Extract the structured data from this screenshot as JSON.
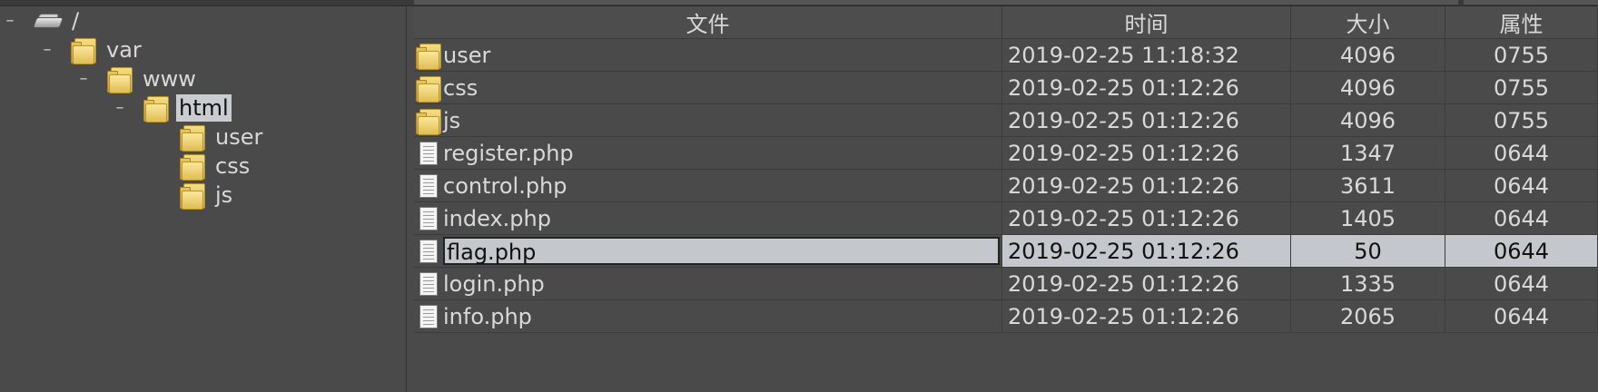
{
  "colors": {
    "background": "#4a4a4a",
    "text": "#d9d9d9",
    "selection": "#c4c7cb",
    "folder": "#f1d46f"
  },
  "tree": {
    "root": {
      "label": "/",
      "icon": "drive-icon",
      "expander": "–"
    },
    "var": {
      "label": "var",
      "icon": "folder-icon",
      "expander": "–"
    },
    "www": {
      "label": "www",
      "icon": "folder-icon",
      "expander": "–"
    },
    "html": {
      "label": "html",
      "icon": "folder-icon",
      "expander": "–",
      "selected": true
    },
    "children": [
      {
        "label": "user",
        "icon": "folder-icon"
      },
      {
        "label": "css",
        "icon": "folder-icon"
      },
      {
        "label": "js",
        "icon": "folder-icon"
      }
    ]
  },
  "table": {
    "headers": {
      "name": "文件",
      "time": "时间",
      "size": "大小",
      "perm": "属性"
    },
    "rows": [
      {
        "type": "folder",
        "name": "user",
        "time": "2019-02-25 11:18:32",
        "size": "4096",
        "perm": "0755"
      },
      {
        "type": "folder",
        "name": "css",
        "time": "2019-02-25 01:12:26",
        "size": "4096",
        "perm": "0755"
      },
      {
        "type": "folder",
        "name": "js",
        "time": "2019-02-25 01:12:26",
        "size": "4096",
        "perm": "0755"
      },
      {
        "type": "file",
        "name": "register.php",
        "time": "2019-02-25 01:12:26",
        "size": "1347",
        "perm": "0644"
      },
      {
        "type": "file",
        "name": "control.php",
        "time": "2019-02-25 01:12:26",
        "size": "3611",
        "perm": "0644"
      },
      {
        "type": "file",
        "name": "index.php",
        "time": "2019-02-25 01:12:26",
        "size": "1405",
        "perm": "0644"
      },
      {
        "type": "file",
        "name": "flag.php",
        "time": "2019-02-25 01:12:26",
        "size": "50",
        "perm": "0644",
        "selected": true
      },
      {
        "type": "file",
        "name": "login.php",
        "time": "2019-02-25 01:12:26",
        "size": "1335",
        "perm": "0644"
      },
      {
        "type": "file",
        "name": "info.php",
        "time": "2019-02-25 01:12:26",
        "size": "2065",
        "perm": "0644"
      }
    ]
  }
}
